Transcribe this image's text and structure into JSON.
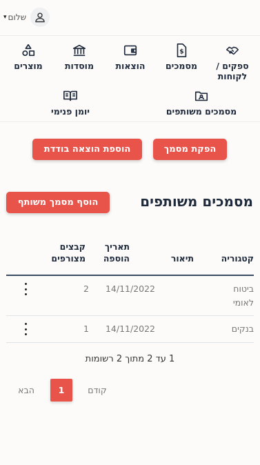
{
  "header": {
    "greeting": "שלום",
    "caret": "▾"
  },
  "nav": {
    "suppliers": "ספקים / לקוחות",
    "documents": "מסמכים",
    "expenses": "הוצאות",
    "institutions": "מוסדות",
    "products": "מוצרים",
    "shared_documents": "מסמכים משותפים",
    "journal": "יומן פנימי"
  },
  "actions": {
    "issue_document": "הפקת מסמך",
    "add_single_expense": "הוספת הוצאה בודדת"
  },
  "section": {
    "title": "מסמכים משותפים",
    "add_button": "הוסף מסמך משותף"
  },
  "table": {
    "columns": [
      "קטגוריה",
      "תיאור",
      "תאריך הוספה",
      "קבצים מצורפים"
    ],
    "rows": [
      {
        "category": "ביטוח לאומי",
        "description": "",
        "date": "14/11/2022",
        "files": "2"
      },
      {
        "category": "בנקים",
        "description": "",
        "date": "14/11/2022",
        "files": "1"
      }
    ]
  },
  "pagination": {
    "summary": "1 עד 2 מתוך 2 רשומות",
    "previous": "קודם",
    "current": "1",
    "next": "הבא"
  },
  "colors": {
    "accent": "#e8534a",
    "heading": "#1e2a3b"
  }
}
